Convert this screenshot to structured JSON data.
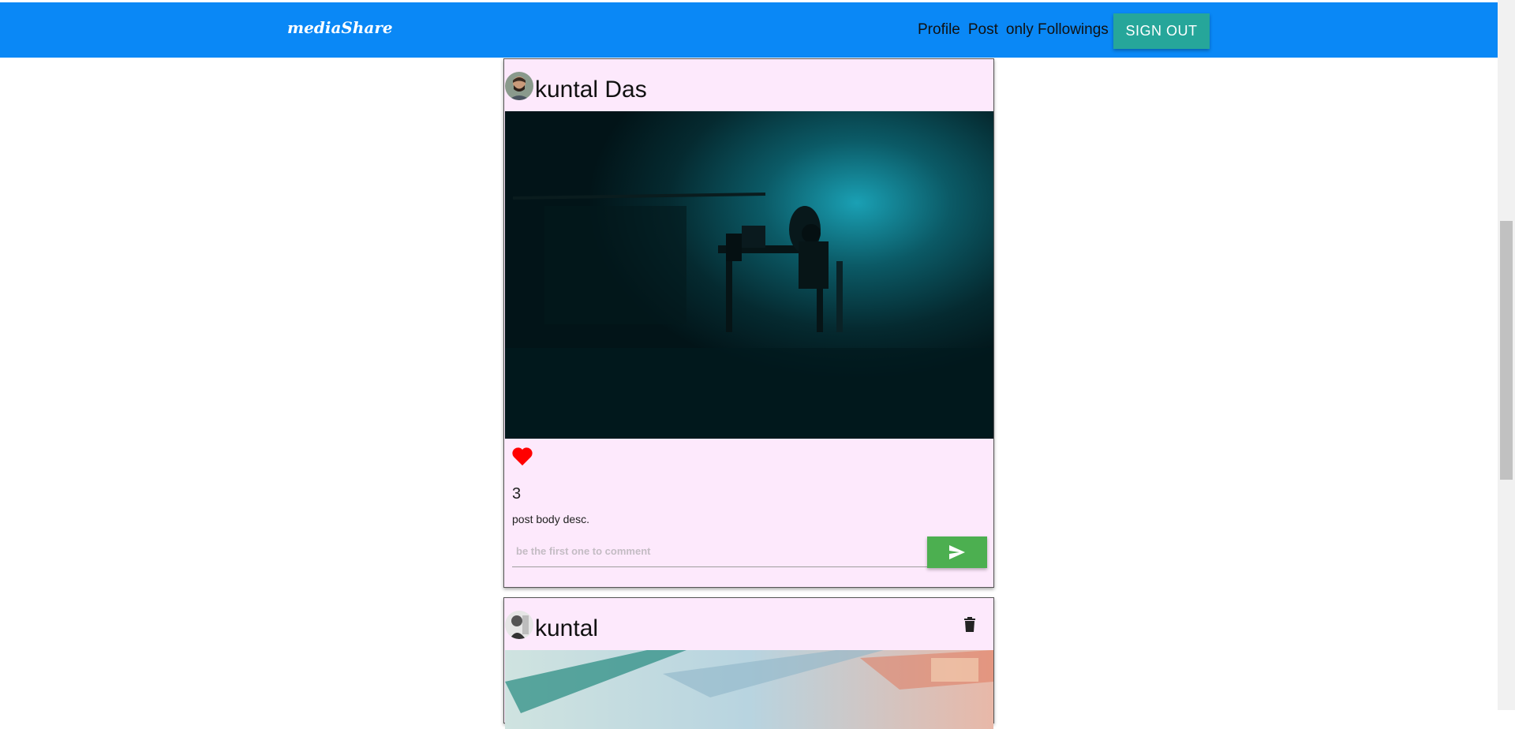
{
  "header": {
    "brand": "mediaShare",
    "nav": [
      {
        "label": "Profile"
      },
      {
        "label": "Post"
      },
      {
        "label": "only Followings"
      }
    ],
    "signout_label": "SIGN OUT",
    "bg_color": "#0a88f6",
    "signout_color": "#26a69a"
  },
  "posts": [
    {
      "author": "kuntal Das",
      "likes": "3",
      "body": "post body desc.",
      "comment_placeholder": "be the first one to comment",
      "liked": true,
      "icons": [
        "heart-icon",
        "send-icon"
      ]
    },
    {
      "author": "kuntal",
      "icons": [
        "trash-icon"
      ]
    }
  ],
  "colors": {
    "card_bg": "#fde9fc",
    "like_color": "#ff0000",
    "send_color": "#4caf50"
  }
}
